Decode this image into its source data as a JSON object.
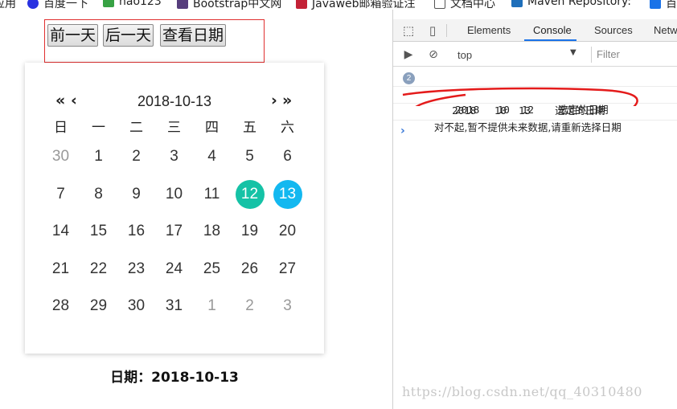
{
  "bookmarks": [
    {
      "label": "应用",
      "icon": "apps-icon",
      "color": "#4285f4"
    },
    {
      "label": "百度一下",
      "icon": "baidu-icon",
      "color": "#2932e1"
    },
    {
      "label": "hao123",
      "icon": "hao123-icon",
      "color": "#37a244"
    },
    {
      "label": "Bootstrap中文网",
      "icon": "bootstrap-icon",
      "color": "#563d7c"
    },
    {
      "label": "Javaweb邮箱验证注",
      "icon": "csdn-icon",
      "color": "#c32136"
    },
    {
      "label": "文档中心",
      "icon": "document-icon",
      "color": "#555555"
    },
    {
      "label": "Maven Repository: ",
      "icon": "maven-icon",
      "color": "#1f6fba"
    },
    {
      "label": "百",
      "icon": "translate-icon",
      "color": "#1a73e8"
    }
  ],
  "buttons": {
    "prev": "前一天",
    "next": "后一天",
    "view": "查看日期"
  },
  "calendar": {
    "nav_prev_year": "«",
    "nav_prev_month": "‹",
    "nav_next_month": "›",
    "nav_next_year": "»",
    "title": "2018-10-13",
    "weekdays": [
      "日",
      "一",
      "二",
      "三",
      "四",
      "五",
      "六"
    ],
    "days": [
      {
        "d": "30",
        "muted": true
      },
      {
        "d": "1"
      },
      {
        "d": "2"
      },
      {
        "d": "3"
      },
      {
        "d": "4"
      },
      {
        "d": "5"
      },
      {
        "d": "6"
      },
      {
        "d": "7"
      },
      {
        "d": "8"
      },
      {
        "d": "9"
      },
      {
        "d": "10"
      },
      {
        "d": "11"
      },
      {
        "d": "12",
        "state": "sel"
      },
      {
        "d": "13",
        "state": "today"
      },
      {
        "d": "14"
      },
      {
        "d": "15"
      },
      {
        "d": "16"
      },
      {
        "d": "17"
      },
      {
        "d": "18"
      },
      {
        "d": "19"
      },
      {
        "d": "20"
      },
      {
        "d": "21"
      },
      {
        "d": "22"
      },
      {
        "d": "23"
      },
      {
        "d": "24"
      },
      {
        "d": "25"
      },
      {
        "d": "26"
      },
      {
        "d": "27"
      },
      {
        "d": "28"
      },
      {
        "d": "29"
      },
      {
        "d": "30"
      },
      {
        "d": "31"
      },
      {
        "d": "1",
        "muted": true
      },
      {
        "d": "2",
        "muted": true
      },
      {
        "d": "3",
        "muted": true
      }
    ],
    "colors": {
      "selected": "#15c2a6",
      "today": "#13b8f0"
    }
  },
  "date_label": "日期：2018-10-13",
  "devtools": {
    "tabs": [
      "Elements",
      "Console",
      "Sources",
      "Netw"
    ],
    "active_tab": "Console",
    "context": "top",
    "filter_placeholder": "Filter",
    "messages": [
      {
        "count": "2",
        "text": "2018   10  12    选定的日期"
      },
      {
        "text": "2018   10  13    选定的日期"
      },
      {
        "text": "对不起,暂不提供未来数据,请重新选择日期"
      }
    ],
    "prompt": "›"
  },
  "watermark": "https://blog.csdn.net/qq_40310480"
}
